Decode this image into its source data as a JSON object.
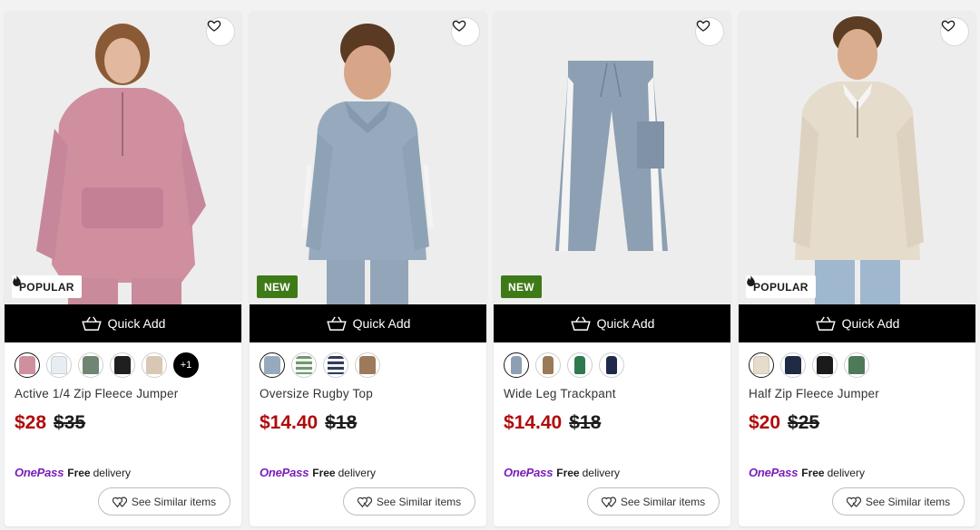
{
  "quick_add_label": "Quick Add",
  "see_similar_label": "See Similar items",
  "onepass": {
    "logo": "OnePass",
    "free": "Free",
    "delivery": "delivery"
  },
  "colors": {
    "sale": "#b00b0b",
    "new_badge": "#3f7a18",
    "onepass": "#7a1fb8"
  },
  "products": [
    {
      "name": "Active 1/4 Zip Fleece Jumper",
      "price_now": "$28",
      "price_was": "$35",
      "badge": "POPULAR",
      "badge_type": "popular",
      "garment_color": "#cf8f9f",
      "swatches": [
        "#cf8f9f",
        "#e7edf2",
        "#6f8672",
        "#1f1f1f",
        "#d8c8b3"
      ],
      "more_label": "+1"
    },
    {
      "name": "Oversize Rugby Top",
      "price_now": "$14.40",
      "price_was": "$18",
      "badge": "NEW",
      "badge_type": "new",
      "garment_color": "#97aabd",
      "swatches": [
        "#97aabd",
        "#6e9a6e",
        "#2f3a5e",
        "#9c7a5a"
      ],
      "more_label": ""
    },
    {
      "name": "Wide Leg Trackpant",
      "price_now": "$14.40",
      "price_was": "$18",
      "badge": "NEW",
      "badge_type": "new",
      "garment_color": "#8d9fb2",
      "swatches": [
        "#8d9fb2",
        "#9a7a58",
        "#2e7a4e",
        "#1f2a4a"
      ],
      "more_label": ""
    },
    {
      "name": "Half Zip Fleece Jumper",
      "price_now": "$20",
      "price_was": "$25",
      "badge": "POPULAR",
      "badge_type": "popular",
      "garment_color": "#e6dccb",
      "swatches": [
        "#e6dccb",
        "#1f2a44",
        "#1a1a1a",
        "#4f7a5a"
      ],
      "more_label": ""
    }
  ]
}
